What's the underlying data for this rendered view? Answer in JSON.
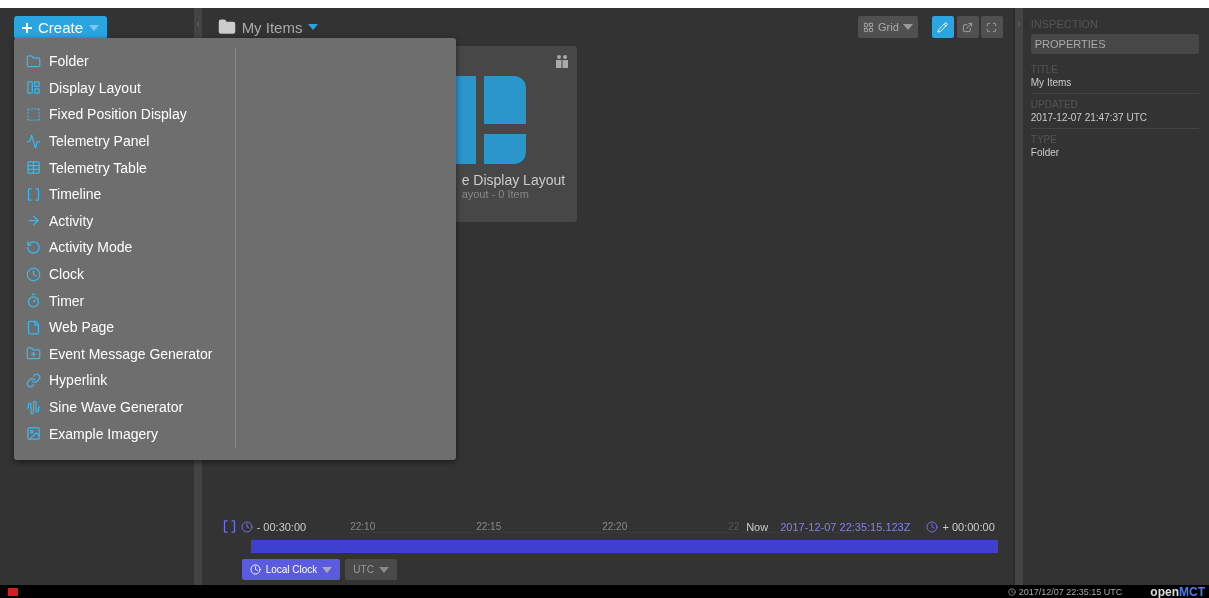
{
  "left_pane": {
    "create_button": {
      "label": "Create"
    }
  },
  "create_menu": {
    "items": [
      {
        "label": "Folder"
      },
      {
        "label": "Display Layout"
      },
      {
        "label": "Fixed Position Display"
      },
      {
        "label": "Telemetry Panel"
      },
      {
        "label": "Telemetry Table"
      },
      {
        "label": "Timeline"
      },
      {
        "label": "Activity"
      },
      {
        "label": "Activity Mode"
      },
      {
        "label": "Clock"
      },
      {
        "label": "Timer"
      },
      {
        "label": "Web Page"
      },
      {
        "label": "Event Message Generator"
      },
      {
        "label": "Hyperlink"
      },
      {
        "label": "Sine Wave Generator"
      },
      {
        "label": "Example Imagery"
      }
    ]
  },
  "main": {
    "breadcrumb": {
      "title": "My Items"
    },
    "view_button": {
      "label": "Grid"
    },
    "card": {
      "title": "e Display Layout",
      "subtitle": "ayout - 0 Item"
    }
  },
  "time_conductor": {
    "start": "- 00:30:00",
    "ticks": [
      {
        "label": "22:10"
      },
      {
        "label": "22:15"
      },
      {
        "label": "22:20"
      },
      {
        "label": "22"
      }
    ],
    "now_label": "Now",
    "now_value": "2017-12-07 22:35:15.123Z",
    "end": "+ 00:00:00",
    "clock_button": "Local Clock",
    "zone_button": "UTC"
  },
  "inspector": {
    "heading": "INSPECTION",
    "tab": "PROPERTIES",
    "properties": [
      {
        "label": "TITLE",
        "value": "My Items"
      },
      {
        "label": "UPDATED",
        "value": "2017-12-07 21:47:37 UTC"
      },
      {
        "label": "TYPE",
        "value": "Folder"
      }
    ]
  },
  "status_bar": {
    "clock": "2017/12/07 22:35:15 UTC",
    "logo_left": "open",
    "logo_right": "MCT"
  }
}
